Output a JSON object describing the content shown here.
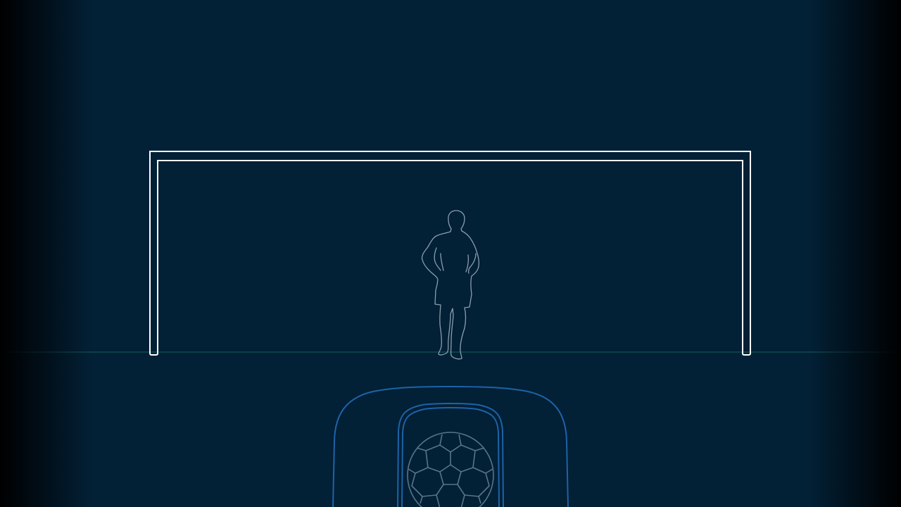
{
  "scene": {
    "name": "penalty-kick-scene",
    "colors": {
      "background": "#022036",
      "goal_frame": "#ffffff",
      "ground_line": "#0f4a4f",
      "keeper_outline": "#8a9eae",
      "launcher_outline": "#1d63a8",
      "ball_outline": "#5a7488"
    },
    "icons": {
      "goal": "goal-frame-icon",
      "keeper": "goalkeeper-silhouette-icon",
      "launcher": "ball-launcher-icon",
      "ball": "soccer-ball-icon"
    }
  }
}
